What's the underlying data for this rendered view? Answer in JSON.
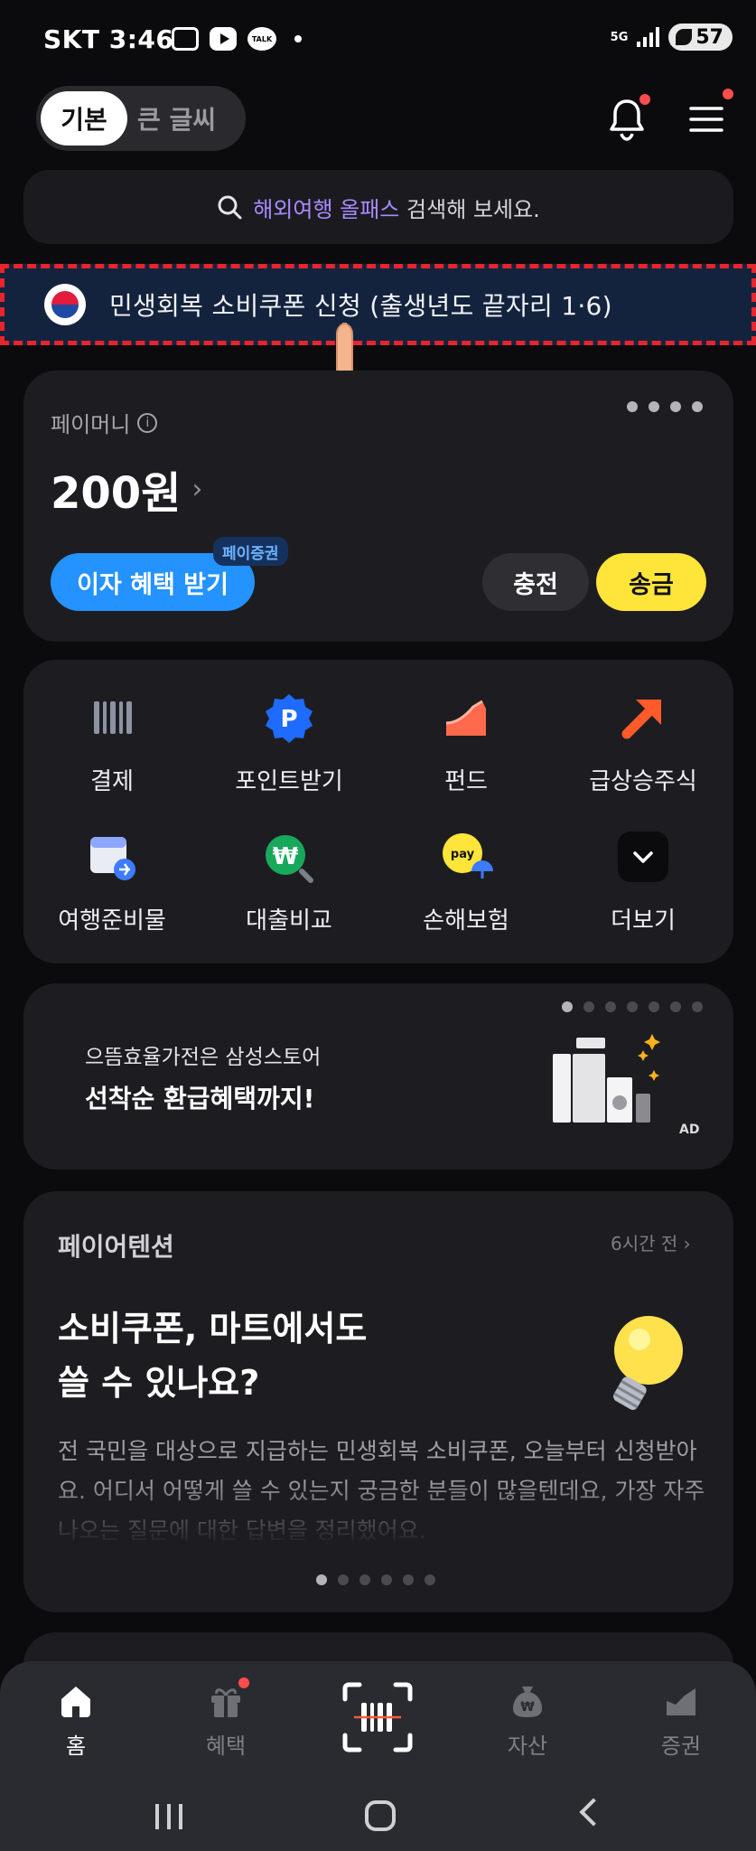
{
  "status_bar": {
    "carrier_time": "SKT 3:46",
    "network": "5G",
    "battery": "57",
    "talk_label": "TALK"
  },
  "header": {
    "mode_basic": "기본",
    "mode_large": "큰 글씨"
  },
  "search": {
    "highlight": "해외여행 올패스",
    "suffix": " 검색해 보세요."
  },
  "promo_banner": {
    "text": "민생회복 소비쿠폰 신청 (출생년도 끝자리 1·6)"
  },
  "pay_money": {
    "label": "페이머니",
    "balance": "200원",
    "interest_button": "이자 혜택 받기",
    "securities_tag": "페이증권",
    "charge_button": "충전",
    "send_button": "송금",
    "page_dots": 4
  },
  "services": [
    {
      "label": "결제",
      "icon": "barcode-icon"
    },
    {
      "label": "포인트받기",
      "icon": "point-badge-icon"
    },
    {
      "label": "펀드",
      "icon": "fund-chart-icon"
    },
    {
      "label": "급상승주식",
      "icon": "rising-arrow-icon"
    },
    {
      "label": "여행준비물",
      "icon": "travel-calendar-icon"
    },
    {
      "label": "대출비교",
      "icon": "won-search-icon"
    },
    {
      "label": "손해보험",
      "icon": "pay-umbrella-icon"
    },
    {
      "label": "더보기",
      "icon": "chevron-down-icon"
    }
  ],
  "ad_banner": {
    "subtitle": "으뜸효율가전은 삼성스토어",
    "title": "선착순 환급혜택까지!",
    "badge": "AD",
    "page_dots": 7
  },
  "pay_attention": {
    "label": "페이어텐션",
    "time": "6시간 전",
    "headline": "소비쿠폰, 마트에서도\n쓸 수 있나요?",
    "body": "전 국민을 대상으로 지급하는 민생회복 소비쿠폰, 오늘부터 신청받아요. 어디서 어떻게 쓸 수 있는지 궁금한 분들이 많을텐데요, 가장 자주 나오는 질문에 대한 답변을 정리했어요.",
    "page_dots": 6
  },
  "tab_bar": [
    {
      "label": "홈",
      "icon": "home-icon",
      "active": true
    },
    {
      "label": "혜택",
      "icon": "gift-icon",
      "active": false
    },
    {
      "label": "자산",
      "icon": "money-bag-icon",
      "active": false
    },
    {
      "label": "증권",
      "icon": "stock-chart-icon",
      "active": false
    }
  ],
  "colors": {
    "background": "#0b0b0d",
    "card": "#1d1d21",
    "accent_blue": "#2492ff",
    "accent_yellow": "#ffe53a",
    "highlight_purple": "#a88cff",
    "banner_border": "#e8242c"
  }
}
